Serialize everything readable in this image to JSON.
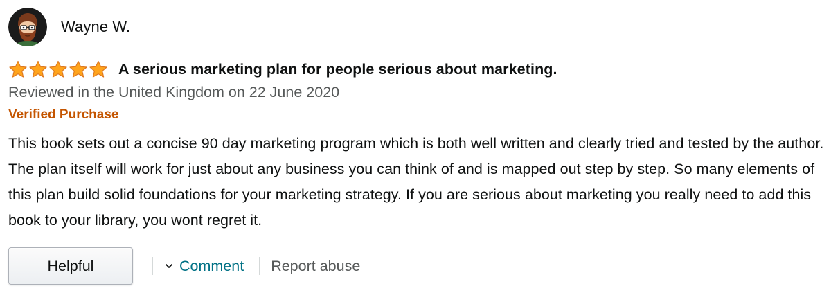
{
  "reviewer": {
    "name": "Wayne W.",
    "avatar_icon": "bearded-man-avatar-icon"
  },
  "review": {
    "rating": 5,
    "rating_max": 5,
    "star_color": "#ffa41c",
    "title": "A serious marketing plan for people serious about marketing.",
    "date_line": "Reviewed in the United Kingdom on 22 June 2020",
    "verified_label": "Verified Purchase",
    "verified_color": "#c45500",
    "body": "This book sets out a concise 90 day marketing program which is both well written and clearly tried and tested by the author. The plan itself will work for just about any business you can think of and is mapped out step by step. So many elements of this plan build solid foundations for your marketing strategy. If you are serious about marketing you really need to add this book to your library, you wont regret it."
  },
  "actions": {
    "helpful_label": "Helpful",
    "comment_label": "Comment",
    "comment_icon": "chevron-down-icon",
    "report_label": "Report abuse",
    "link_color": "#007185"
  }
}
